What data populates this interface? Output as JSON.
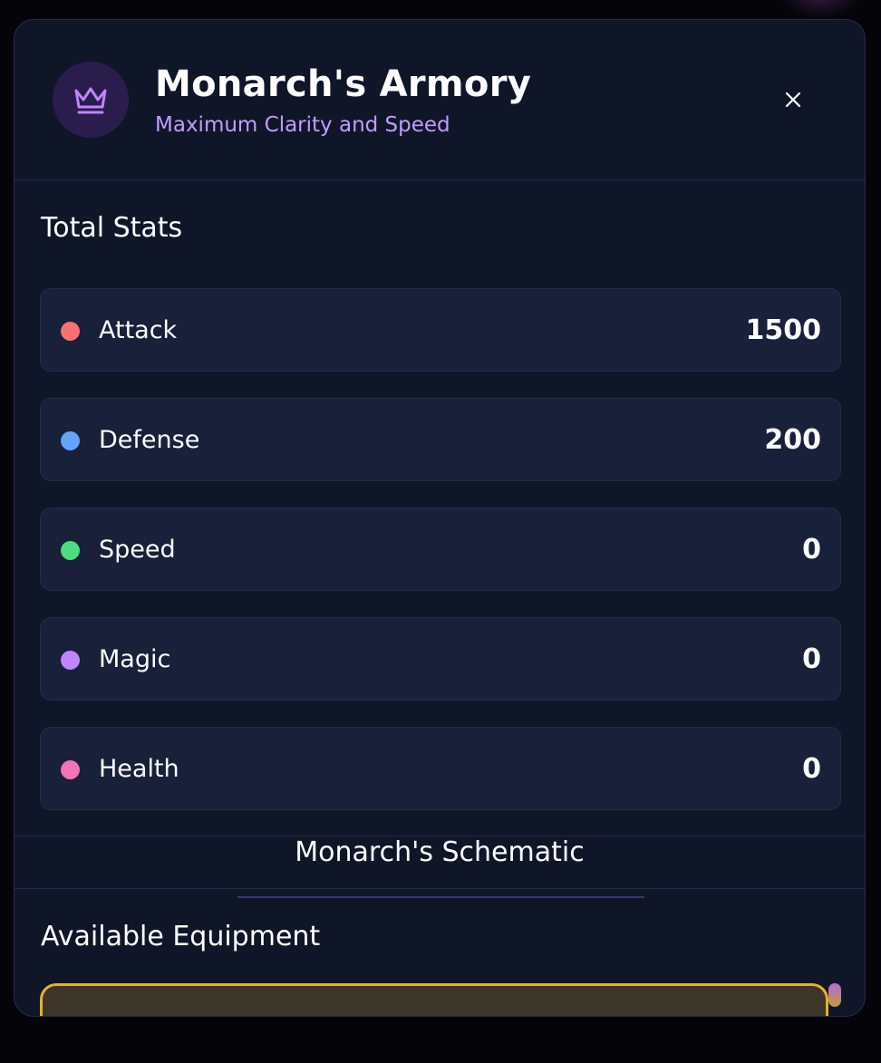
{
  "header": {
    "title": "Monarch's Armory",
    "subtitle": "Maximum Clarity and Speed",
    "icon": "crown-icon",
    "close_icon": "close-icon"
  },
  "stats": {
    "heading": "Total Stats",
    "items": [
      {
        "label": "Attack",
        "value": "1500",
        "color": "#f87171"
      },
      {
        "label": "Defense",
        "value": "200",
        "color": "#60a5fa"
      },
      {
        "label": "Speed",
        "value": "0",
        "color": "#4ade80"
      },
      {
        "label": "Magic",
        "value": "0",
        "color": "#c084fc"
      },
      {
        "label": "Health",
        "value": "0",
        "color": "#f472b6"
      }
    ]
  },
  "schematic": {
    "label": "Monarch's Schematic"
  },
  "equipment": {
    "heading": "Available Equipment"
  },
  "colors": {
    "accent": "#c39bff",
    "background": "#0f1628",
    "card": "#18203a",
    "highlight_border": "#e6b225"
  }
}
